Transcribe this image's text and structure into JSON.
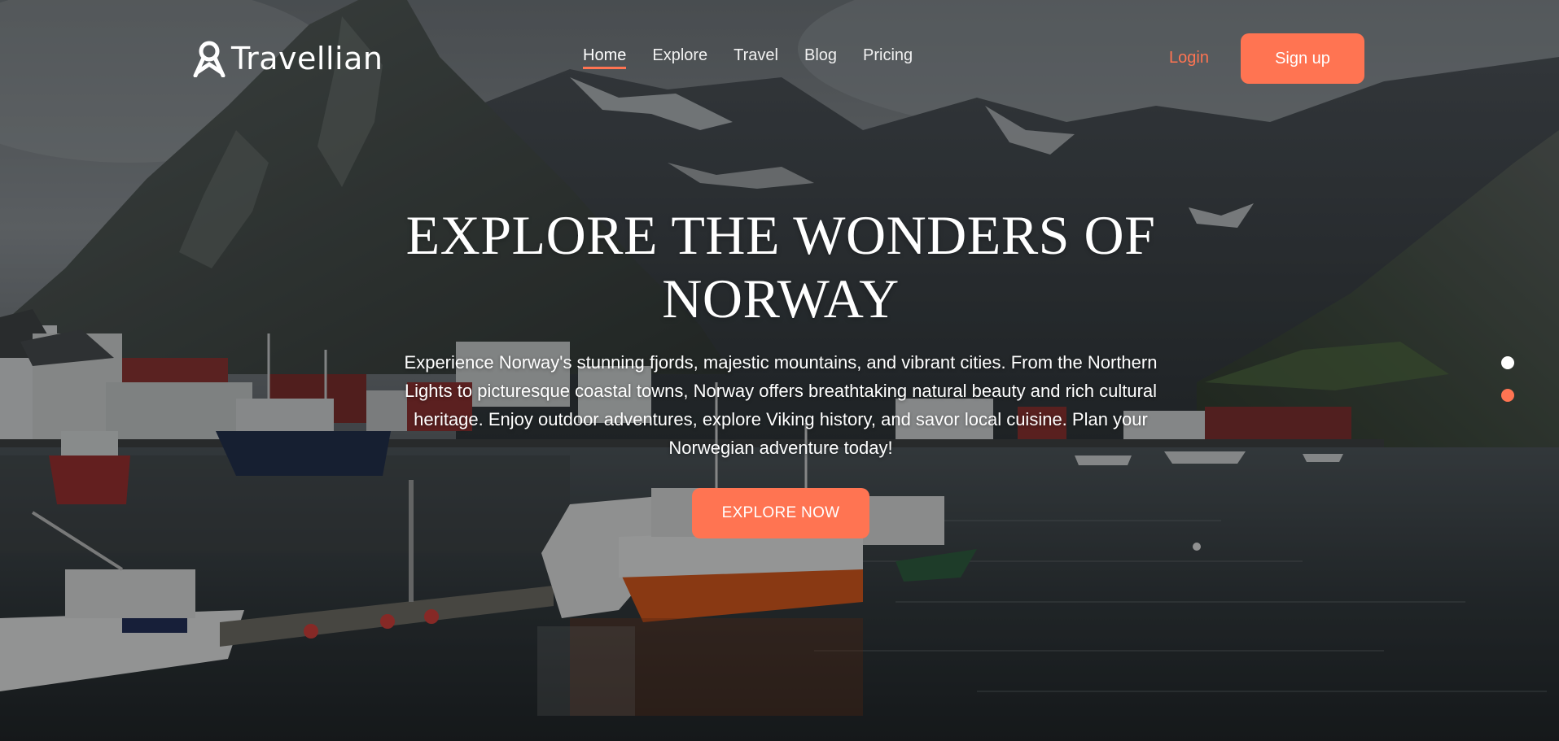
{
  "brand": {
    "name": "Travellian",
    "icon": "location-pin-logo-icon"
  },
  "nav": {
    "items": [
      {
        "label": "Home",
        "active": true
      },
      {
        "label": "Explore",
        "active": false
      },
      {
        "label": "Travel",
        "active": false
      },
      {
        "label": "Blog",
        "active": false
      },
      {
        "label": "Pricing",
        "active": false
      }
    ],
    "login_label": "Login",
    "signup_label": "Sign up"
  },
  "hero": {
    "headline": "EXPLORE THE WONDERS OF NORWAY",
    "description": "Experience Norway's stunning fjords, majestic mountains, and vibrant cities. From the Northern Lights to picturesque coastal towns, Norway offers breathtaking natural beauty and rich cultural heritage. Enjoy outdoor adventures, explore Viking history, and savor local cuisine. Plan your Norwegian adventure today!",
    "cta_label": "EXPLORE NOW",
    "background": "fjord-harbor-with-mountains-and-fishing-boats"
  },
  "slider": {
    "slide_count": 2,
    "active_index": 1
  },
  "colors": {
    "accent": "#ff7452",
    "text": "#ffffff",
    "overlay": "#0a0c0e"
  }
}
